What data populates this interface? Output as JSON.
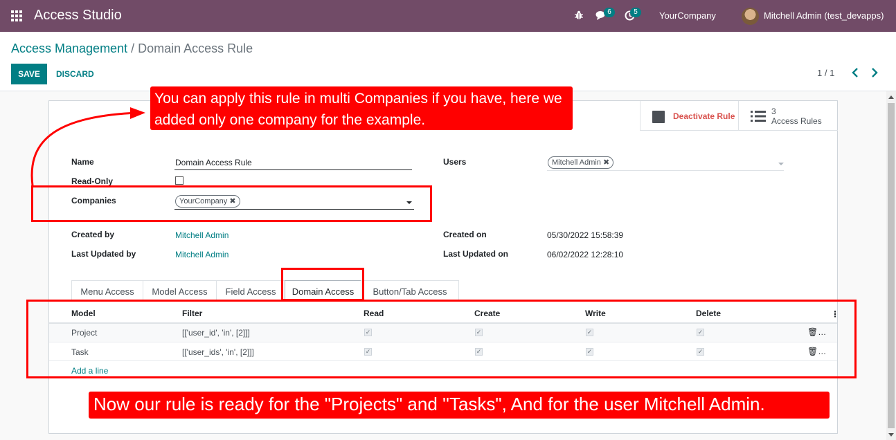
{
  "topbar": {
    "app_name": "Access Studio",
    "chat_count": "6",
    "activity_count": "5",
    "company": "YourCompany",
    "user": "Mitchell Admin (test_devapps)"
  },
  "breadcrumb": {
    "parent": "Access Management",
    "separator": " / ",
    "current": "Domain Access Rule"
  },
  "actions": {
    "save": "SAVE",
    "discard": "DISCARD"
  },
  "pager": {
    "value": "1 / 1"
  },
  "button_box": {
    "deactivate": "Deactivate Rule",
    "rules_count": "3",
    "rules_label": "Access Rules"
  },
  "form": {
    "name_label": "Name",
    "name_value": "Domain Access Rule",
    "readonly_label": "Read-Only",
    "readonly_checked": false,
    "companies_label": "Companies",
    "companies_tags": [
      "YourCompany"
    ],
    "users_label": "Users",
    "users_tags": [
      "Mitchell Admin"
    ],
    "created_by_label": "Created by",
    "created_by_value": "Mitchell Admin",
    "last_updated_by_label": "Last Updated by",
    "last_updated_by_value": "Mitchell Admin",
    "created_on_label": "Created on",
    "created_on_value": "05/30/2022 15:58:39",
    "last_updated_on_label": "Last Updated on",
    "last_updated_on_value": "06/02/2022 12:28:10"
  },
  "tabs": [
    {
      "label": "Menu Access",
      "active": false
    },
    {
      "label": "Model Access",
      "active": false
    },
    {
      "label": "Field Access",
      "active": false
    },
    {
      "label": "Domain Access",
      "active": true
    },
    {
      "label": "Button/Tab Access",
      "active": false
    }
  ],
  "table": {
    "columns": [
      "Model",
      "Filter",
      "Read",
      "Create",
      "Write",
      "Delete"
    ],
    "rows": [
      {
        "model": "Project",
        "filter": "[['user_id', 'in', [2]]]",
        "read": true,
        "create": true,
        "write": true,
        "delete": true
      },
      {
        "model": "Task",
        "filter": "[['user_ids', 'in', [2]]]",
        "read": true,
        "create": true,
        "write": true,
        "delete": true
      }
    ],
    "add_line": "Add a line"
  },
  "annotations": {
    "top_callout": "You can apply this rule in multi Companies if you have, here we added only one company for the example.",
    "bottom_callout": "Now our rule is ready for the \"Projects\" and ''Tasks\", And for the user Mitchell Admin."
  },
  "colors": {
    "navbar": "#714b67",
    "accent": "#017e84",
    "annotation": "#ff0000",
    "danger": "#d9534f"
  }
}
